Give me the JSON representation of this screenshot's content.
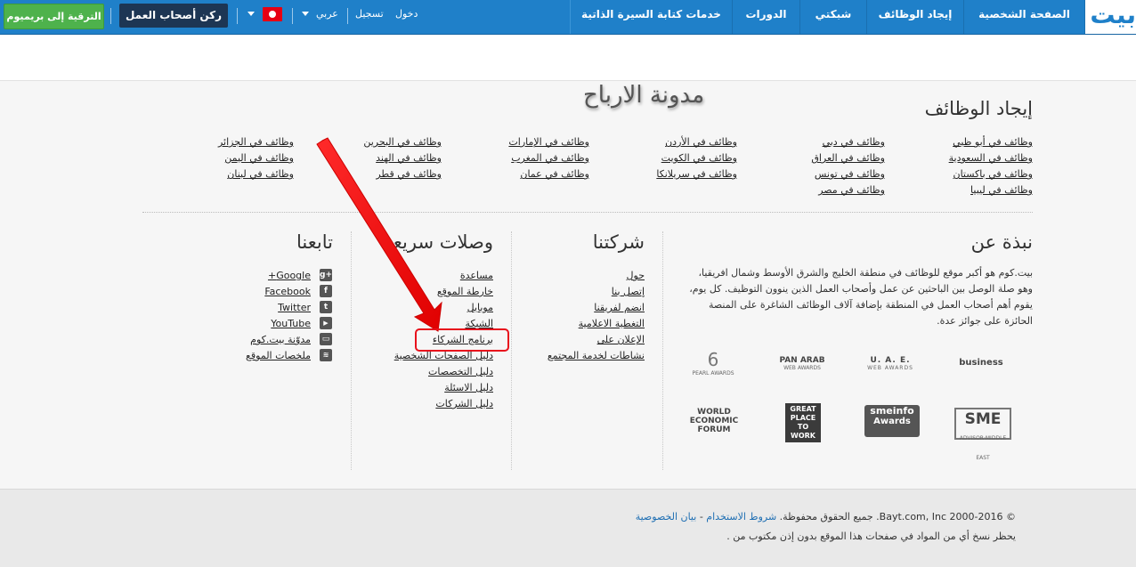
{
  "nav": {
    "logo": "بيت",
    "items": [
      "الصفحة الشخصية",
      "إيجاد الوظائف",
      "شبكتي",
      "الدورات",
      "خدمات كتابة السيرة الذاتية"
    ],
    "login": "دخول",
    "register": "تسجيل",
    "language": "عربي",
    "employer_corner": "ركن أصحاب العمل",
    "upgrade": "الترقية إلى بريميوم"
  },
  "blog_title": "مدونة الارباح",
  "find_jobs": {
    "title": "إيجاد الوظائف",
    "links": [
      [
        "وظائف في أبو ظبي",
        "وظائف في السعودية",
        "وظائف في باكستان",
        "وظائف في ليبيا"
      ],
      [
        "وظائف في دبي",
        "وظائف في العراق",
        "وظائف في تونس",
        "وظائف في مصر"
      ],
      [
        "وظائف في الأردن",
        "وظائف في الكويت",
        "وظائف في سريلانكا"
      ],
      [
        "وظائف في الإمارات",
        "وظائف في المغرب",
        "وظائف في عمان"
      ],
      [
        "وظائف في البحرين",
        "وظائف في الهند",
        "وظائف في قطر"
      ],
      [
        "وظائف في الجزائر",
        "وظائف في اليمن",
        "وظائف في لبنان"
      ]
    ]
  },
  "about": {
    "title": "نبذة عن",
    "text": "بيت.كوم هو أكبر موقع للوظائف في منطقة الخليج والشرق الأوسط وشمال افريقيا، وهو صلة الوصل بين الباحثين عن عمل وأصحاب العمل الذين ينوون التوظيف. كل يوم، يقوم أهم أصحاب العمل في المنطقة بإضافة آلاف الوظائف الشاغرة على المنصة الحائزة على جوائز عدة."
  },
  "company": {
    "title": "شركتنا",
    "links": [
      "حول",
      "إتصل بنا",
      "انضم لفريقنا",
      "التغطية الاعلامية",
      "الإعلان على",
      "نشاطات لخدمة المجتمع"
    ]
  },
  "quick_links": {
    "title": "وصلات سريعة",
    "links": [
      "مساعدة",
      "خارطة الموقع",
      "موبايل",
      "الشبكة",
      "برنامج الشركاء",
      "دليل الصفحات الشخصية",
      "دليل التخصصات",
      "دليل الاسئلة",
      "دليل الشركات"
    ]
  },
  "follow": {
    "title": "تابعنا",
    "links": [
      "Google+",
      "Facebook",
      "Twitter",
      "YouTube",
      "مدوّنة بيت.كوم",
      "ملخصات الموقع"
    ],
    "icons": [
      "google-plus-icon",
      "facebook-icon",
      "twitter-icon",
      "youtube-icon",
      "blog-icon",
      "rss-icon"
    ]
  },
  "awards": [
    {
      "main": "business",
      "sub": ""
    },
    {
      "main": "U. A. E.",
      "sub": "WEB AWARDS"
    },
    {
      "main": "PAN ARAB",
      "sub": "WEB AWARDS"
    },
    {
      "main": "6",
      "sub": "PEARL AWARDS"
    },
    {
      "main": "SME",
      "sub": "ADVISOR·MIDDLE EAST"
    },
    {
      "main": "smeinfo",
      "sub": "Awards"
    },
    {
      "main": "GREAT PLACE TO WORK",
      "sub": ""
    },
    {
      "main": "WORLD ECONOMIC FORUM",
      "sub": ""
    }
  ],
  "footer": {
    "copyright": "© 2000-2016 Bayt.com, Inc. جميع الحقوق محفوظة.",
    "terms": "شروط الاستخدام",
    "privacy": "بيان الخصوصية",
    "notice": "يحظر نسخ أي من المواد في صفحات هذا الموقع بدون إذن مكتوب من ."
  }
}
